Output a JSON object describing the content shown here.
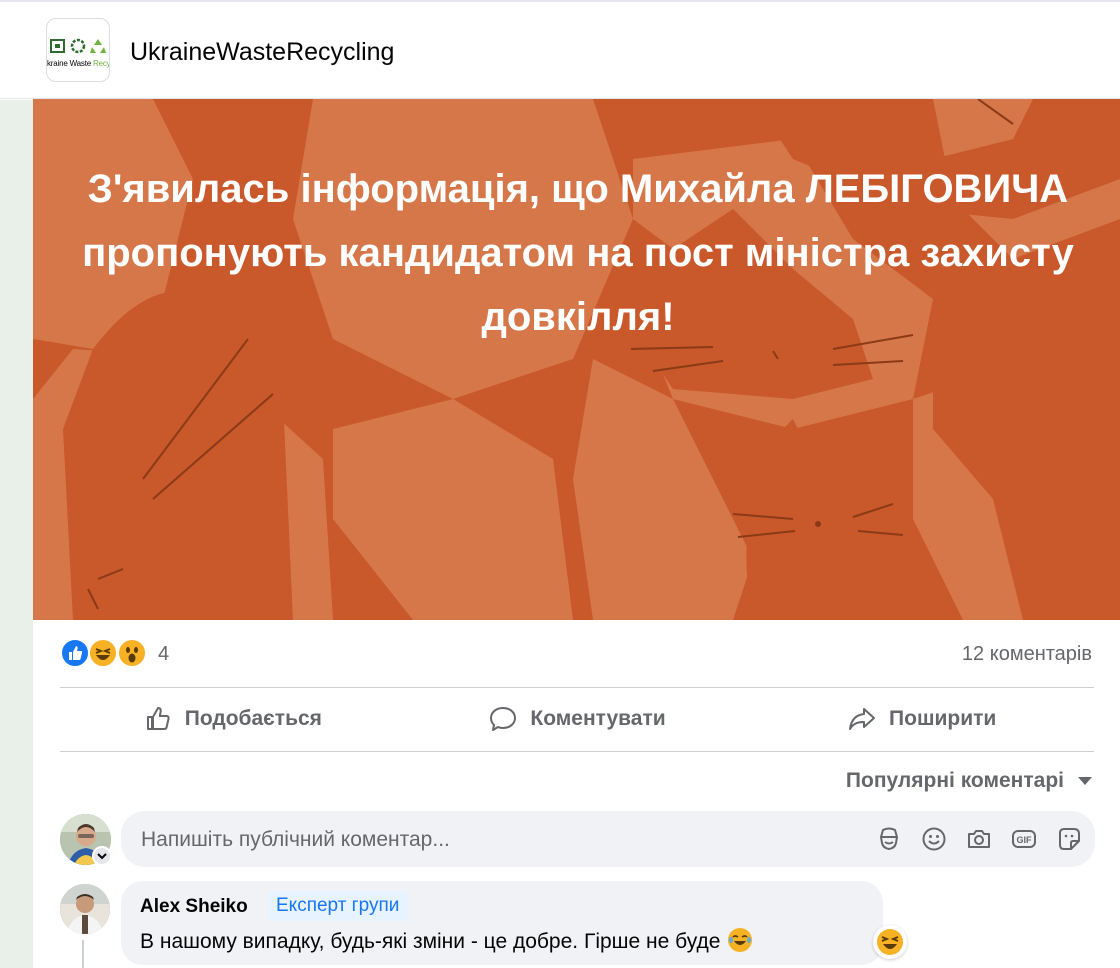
{
  "group": {
    "name": "UkraineWasteRecycling",
    "logo_text_main": "kraine Waste ",
    "logo_text_accent": "Recycling"
  },
  "post": {
    "image_text": "З'явилась інформація, що Михайла ЛЕБІГОВИЧА пропонують кандидатом на пост міністра захисту довкілля!",
    "image_bg_color": "#c9582b"
  },
  "reactions": {
    "icons": [
      "like-icon",
      "haha-icon",
      "wow-icon"
    ],
    "count": "4",
    "comments_count": "12 коментарів"
  },
  "actions": {
    "like": "Подобається",
    "comment": "Коментувати",
    "share": "Поширити"
  },
  "comments": {
    "sort_label": "Популярні коментарі",
    "input_placeholder": "Напишіть публічний коментар...",
    "input_icons": [
      "avatar-sticker-icon",
      "emoji-icon",
      "camera-icon",
      "gif-icon",
      "sticker-icon"
    ],
    "items": [
      {
        "author": "Alex Sheiko",
        "badge": "Експерт групи",
        "text": "В нашому випадку, будь-які зміни - це добре. Гірше не буде"
      }
    ]
  },
  "colors": {
    "accent": "#1877f2",
    "secondary_text": "#65676b",
    "reaction_yellow": "#f7b125"
  }
}
